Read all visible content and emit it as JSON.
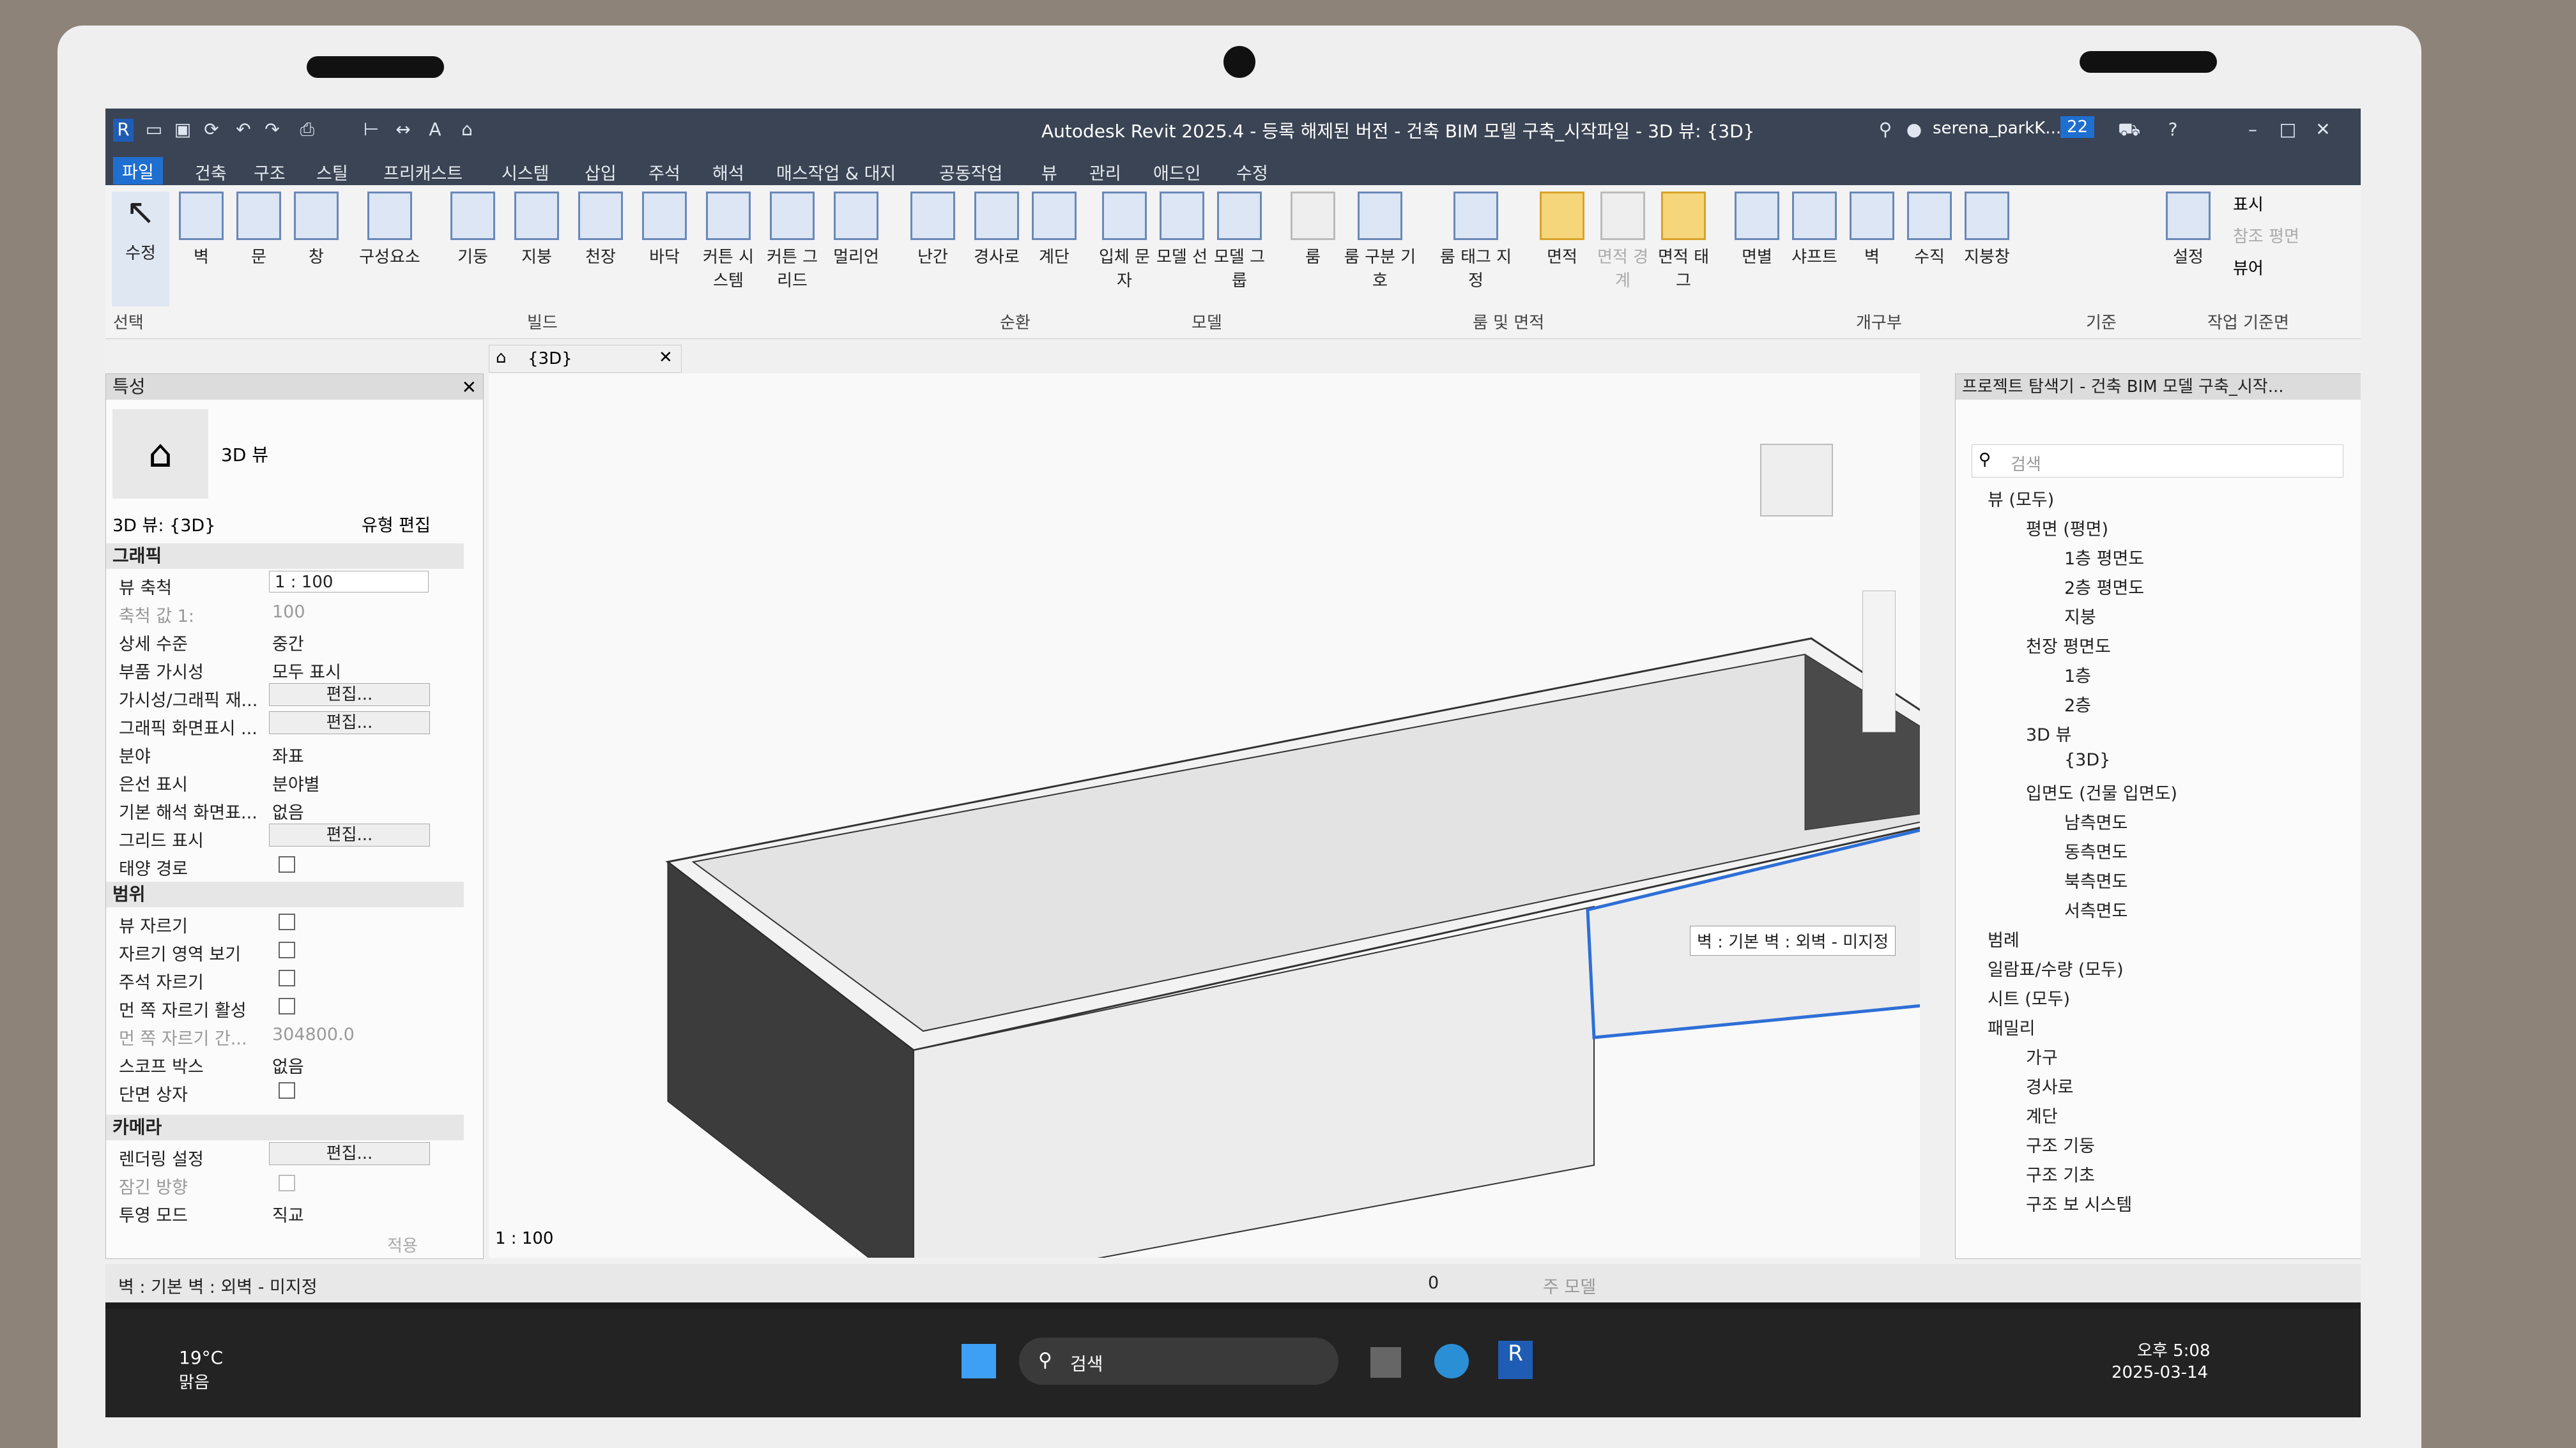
{
  "window": {
    "title": "Autodesk Revit 2025.4 - 등록 해제된 버전 - 건축 BIM 모델 구축_시작파일 - 3D 뷰: {3D}",
    "user": "serena_parkK...",
    "notifications": "22"
  },
  "ribbon_tabs": [
    "파일",
    "건축",
    "구조",
    "스틸",
    "프리캐스트",
    "시스템",
    "삽입",
    "주석",
    "해석",
    "매스작업 & 대지",
    "공동작업",
    "뷰",
    "관리",
    "애드인",
    "수정"
  ],
  "ribbon_buttons": [
    "수정",
    "벽",
    "문",
    "창",
    "구성요소",
    "기둥",
    "지붕",
    "천장",
    "바닥",
    "커튼 시스템",
    "커튼 그리드",
    "멀리언",
    "난간",
    "경사로",
    "계단",
    "입체 문자",
    "모델 선",
    "모델 그룹",
    "룸",
    "룸 구분 기호",
    "룸 태그 지정",
    "면적",
    "면적 경계",
    "면적 태그",
    "면별",
    "샤프트",
    "벽",
    "수직",
    "지붕창",
    "설정",
    "표시",
    "참조 평면",
    "뷰어"
  ],
  "ribbon_groups": [
    "선택",
    "빌드",
    "순환",
    "모델",
    "룸 및 면적",
    "개구부",
    "기준",
    "작업 기준면"
  ],
  "properties": {
    "title": "특성",
    "type_name": "3D 뷰",
    "view_selector": "3D 뷰: {3D}",
    "edit_type": "유형 편집",
    "sections": {
      "graphics": "그래픽",
      "extents": "범위",
      "camera": "카메라"
    },
    "graphics_rows": [
      {
        "k": "뷰 축척",
        "v": "1 : 100"
      },
      {
        "k": "축척 값  1:",
        "v": "100"
      },
      {
        "k": "상세 수준",
        "v": "중간"
      },
      {
        "k": "부품 가시성",
        "v": "모두 표시"
      },
      {
        "k": "가시성/그래픽 재...",
        "v": "편집..."
      },
      {
        "k": "그래픽 화면표시 ...",
        "v": "편집..."
      },
      {
        "k": "분야",
        "v": "좌표"
      },
      {
        "k": "은선 표시",
        "v": "분야별"
      },
      {
        "k": "기본 해석 화면표...",
        "v": "없음"
      },
      {
        "k": "그리드 표시",
        "v": "편집..."
      },
      {
        "k": "태양 경로",
        "v": ""
      }
    ],
    "extents_rows": [
      {
        "k": "뷰 자르기",
        "v": ""
      },
      {
        "k": "자르기 영역 보기",
        "v": ""
      },
      {
        "k": "주석 자르기",
        "v": ""
      },
      {
        "k": "먼 쪽 자르기 활성",
        "v": ""
      },
      {
        "k": "먼 쪽 자르기 간...",
        "v": "304800.0"
      },
      {
        "k": "스코프 박스",
        "v": "없음"
      },
      {
        "k": "단면 상자",
        "v": ""
      }
    ],
    "camera_rows": [
      {
        "k": "렌더링 설정",
        "v": "편집..."
      },
      {
        "k": "잠긴 방향",
        "v": ""
      },
      {
        "k": "투영 모드",
        "v": "직교"
      }
    ],
    "apply": "적용"
  },
  "view_tab": "{3D}",
  "view_scale": "1 : 100",
  "tooltip": "벽 : 기본 벽 : 외벽 - 미지정",
  "browser": {
    "title": "프로젝트 탐색기 - 건축 BIM 모델 구축_시작...",
    "search": "검색",
    "items": [
      {
        "label": "뷰 (모두)",
        "lvl": 0
      },
      {
        "label": "평면 (평면)",
        "lvl": 1
      },
      {
        "label": "1층 평면도",
        "lvl": 2
      },
      {
        "label": "2층 평면도",
        "lvl": 2
      },
      {
        "label": "지붕",
        "lvl": 2
      },
      {
        "label": "천장 평면도",
        "lvl": 1
      },
      {
        "label": "1층",
        "lvl": 2
      },
      {
        "label": "2층",
        "lvl": 2
      },
      {
        "label": "3D 뷰",
        "lvl": 1
      },
      {
        "label": "{3D}",
        "lvl": 2
      },
      {
        "label": "입면도 (건물 입면도)",
        "lvl": 1
      },
      {
        "label": "남측면도",
        "lvl": 2
      },
      {
        "label": "동측면도",
        "lvl": 2
      },
      {
        "label": "북측면도",
        "lvl": 2
      },
      {
        "label": "서측면도",
        "lvl": 2
      },
      {
        "label": "범례",
        "lvl": 0
      },
      {
        "label": "일람표/수량 (모두)",
        "lvl": 0
      },
      {
        "label": "시트 (모두)",
        "lvl": 0
      },
      {
        "label": "패밀리",
        "lvl": 0
      },
      {
        "label": "가구",
        "lvl": 1
      },
      {
        "label": "경사로",
        "lvl": 1
      },
      {
        "label": "계단",
        "lvl": 1
      },
      {
        "label": "구조 기둥",
        "lvl": 1
      },
      {
        "label": "구조 기초",
        "lvl": 1
      },
      {
        "label": "구조 보 시스템",
        "lvl": 1
      }
    ]
  },
  "status": {
    "text": "벽 : 기본 벽 : 외벽 - 미지정",
    "count": "0",
    "mode": "주 모델"
  },
  "taskbar": {
    "temp": "19°C",
    "weather": "맑음",
    "search": "검색",
    "time": "오후 5:08",
    "date": "2025-03-14"
  }
}
